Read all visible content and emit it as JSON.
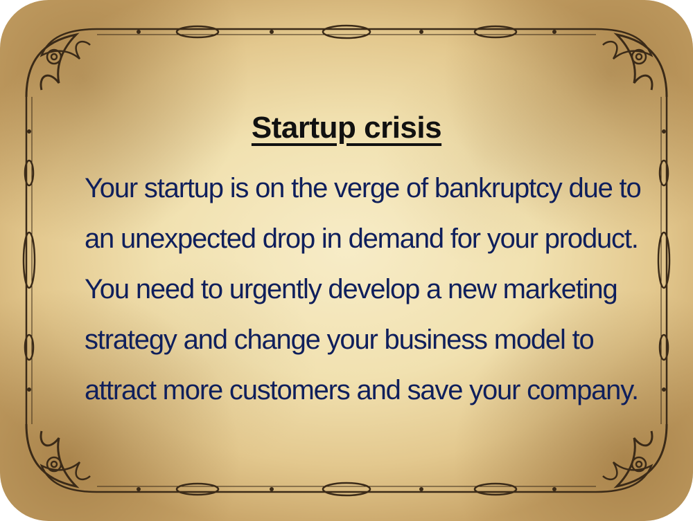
{
  "card": {
    "title": "Startup crisis",
    "lines": [
      "Your startup is on the verge of bankruptcy due to",
      "an unexpected drop in demand for your product.",
      "You need to urgently develop a new marketing",
      "strategy and change your business model to",
      "attract more customers and save your company."
    ]
  },
  "colors": {
    "parchment": "#f1e1b0",
    "title": "#111111",
    "text": "#0f1f5c",
    "ornament": "#3a2a18"
  },
  "decor": {
    "frame_icon": "ornate-frame-icon"
  }
}
